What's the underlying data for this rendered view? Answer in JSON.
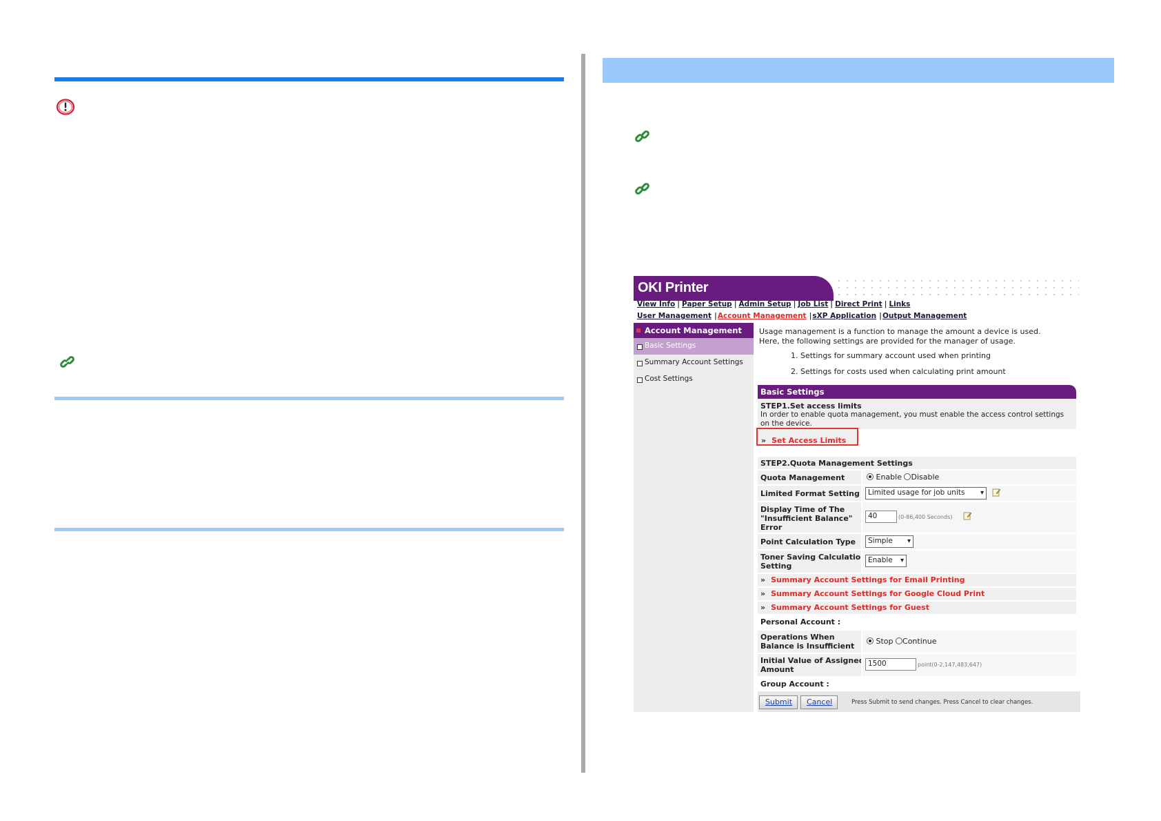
{
  "icons": {
    "caution": "caution-icon",
    "link": "link-chain-icon",
    "note": "note-pencil-icon"
  },
  "colors": {
    "primary_rule": "#1a7de8",
    "secondary_rule": "#9ec8f5",
    "header_bar": "#99c9fb",
    "brand": "#6a1b7f",
    "link_red": "#e02b2b",
    "highlight": "#e8322e"
  },
  "screenshot": {
    "brand": "OKI Printer",
    "nav_row1": [
      "View Info",
      "Paper Setup",
      "Admin Setup",
      "Job List",
      "Direct Print",
      "Links"
    ],
    "nav_row2": [
      "User Management",
      "Account Management",
      "sXP Application",
      "Output Management"
    ],
    "sidebar": {
      "title": "Account Management",
      "items": [
        "Basic Settings",
        "Summary Account Settings",
        "Cost Settings"
      ]
    },
    "intro": {
      "line1": "Usage management is a function to manage the amount a device is used.",
      "line2": "Here, the following settings are provided for the manager of usage.",
      "item1": "1. Settings for summary account used when printing",
      "item2": "2. Settings for costs used when calculating print amount"
    },
    "basic_settings_title": "Basic Settings",
    "step1_title": "STEP1.Set access limits",
    "step1_desc": "In order to enable quota management, you must enable the access control settings on the device.",
    "set_access_limits": "Set Access Limits",
    "chevron": "»",
    "step2_title": "STEP2.Quota Management Settings",
    "quota_management": {
      "label": "Quota Management",
      "opt_enable": "Enable",
      "opt_disable": "Disable"
    },
    "limited_format": {
      "label": "Limited Format Setting",
      "value": "Limited usage for job units"
    },
    "display_time": {
      "label_1": "Display Time of The",
      "label_2": "\"Insufficient Balance\"",
      "label_3": "Error",
      "value": "40",
      "hint": "(0-86,400 Seconds)"
    },
    "point_calc": {
      "label": "Point Calculation Type",
      "value": "Simple"
    },
    "toner_saving": {
      "label_1": "Toner Saving Calculation",
      "label_2": "Setting",
      "value": "Enable"
    },
    "links": [
      "Summary Account Settings for Email Printing",
      "Summary Account Settings for Google Cloud Print",
      "Summary Account Settings for Guest"
    ],
    "personal_account": "Personal Account :",
    "ops_insufficient": {
      "label_1": "Operations When",
      "label_2": "Balance is Insufficient",
      "opt_stop": "Stop",
      "opt_continue": "Continue"
    },
    "initial_value": {
      "label_1": "Initial Value of Assigned",
      "label_2": "Amount",
      "value": "1500",
      "hint": "point(0-2,147,483,647)"
    },
    "group_account": "Group Account :",
    "submit": "Submit",
    "cancel": "Cancel",
    "footer_note": "Press Submit to send changes. Press Cancel to clear changes."
  }
}
